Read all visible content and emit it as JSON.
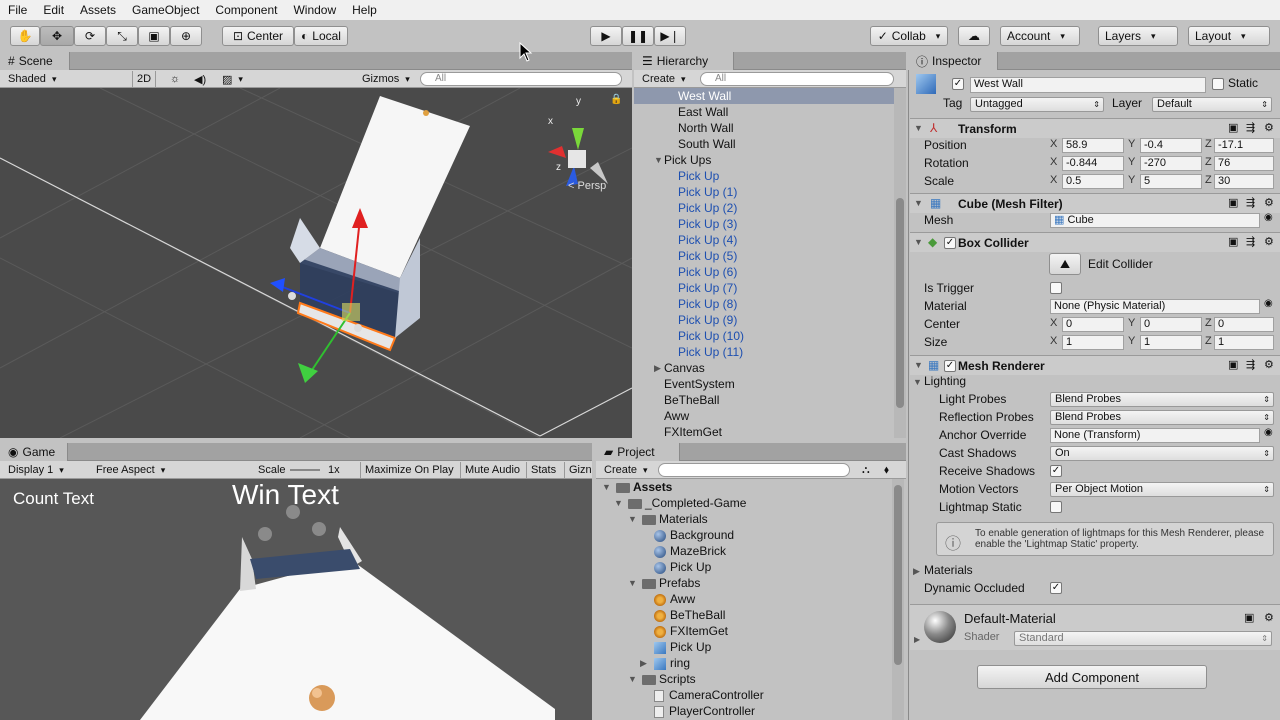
{
  "menu": [
    "File",
    "Edit",
    "Assets",
    "GameObject",
    "Component",
    "Window",
    "Help"
  ],
  "toolbar": {
    "pivot": "Center",
    "space": "Local",
    "collab": "Collab",
    "account": "Account",
    "layers": "Layers",
    "layout": "Layout"
  },
  "scene": {
    "tab": "Scene",
    "shading": "Shaded",
    "mode2d": "2D",
    "gizmos": "Gizmos",
    "search_placeholder": "All",
    "persp": "Persp",
    "axis_x": "x",
    "axis_y": "y",
    "axis_z": "z"
  },
  "hierarchy": {
    "tab": "Hierarchy",
    "create": "Create",
    "search_placeholder": "All",
    "items": [
      {
        "label": "West Wall",
        "style": "selected"
      },
      {
        "label": "East Wall",
        "style": "child"
      },
      {
        "label": "North Wall",
        "style": "child"
      },
      {
        "label": "South Wall",
        "style": "child"
      },
      {
        "label": "Pick Ups",
        "style": "parent"
      },
      {
        "label": "Pick Up",
        "style": "prefab"
      },
      {
        "label": "Pick Up (1)",
        "style": "prefab"
      },
      {
        "label": "Pick Up (2)",
        "style": "prefab"
      },
      {
        "label": "Pick Up (3)",
        "style": "prefab"
      },
      {
        "label": "Pick Up (4)",
        "style": "prefab"
      },
      {
        "label": "Pick Up (5)",
        "style": "prefab"
      },
      {
        "label": "Pick Up (6)",
        "style": "prefab"
      },
      {
        "label": "Pick Up (7)",
        "style": "prefab"
      },
      {
        "label": "Pick Up (8)",
        "style": "prefab"
      },
      {
        "label": "Pick Up (9)",
        "style": "prefab"
      },
      {
        "label": "Pick Up (10)",
        "style": "prefab"
      },
      {
        "label": "Pick Up (11)",
        "style": "prefab"
      },
      {
        "label": "Canvas",
        "style": "collapsed"
      },
      {
        "label": "EventSystem",
        "style": "root"
      },
      {
        "label": "BeTheBall",
        "style": "root"
      },
      {
        "label": "Aww",
        "style": "root"
      },
      {
        "label": "FXItemGet",
        "style": "root"
      }
    ]
  },
  "game": {
    "tab": "Game",
    "display": "Display 1",
    "aspect": "Free Aspect",
    "scale_label": "Scale",
    "scale_value": "1x",
    "maximize": "Maximize On Play",
    "mute": "Mute Audio",
    "stats": "Stats",
    "gizmos": "Gizn",
    "count_text": "Count Text",
    "win_text": "Win Text"
  },
  "project": {
    "tab": "Project",
    "create": "Create",
    "items": [
      {
        "label": "Assets",
        "icon": "folder",
        "bold": true
      },
      {
        "label": "_Completed-Game",
        "icon": "folder"
      },
      {
        "label": "Materials",
        "icon": "folder"
      },
      {
        "label": "Background",
        "icon": "sphere"
      },
      {
        "label": "MazeBrick",
        "icon": "sphere"
      },
      {
        "label": "Pick Up",
        "icon": "sphere"
      },
      {
        "label": "Prefabs",
        "icon": "folder"
      },
      {
        "label": "Aww",
        "icon": "prefab"
      },
      {
        "label": "BeTheBall",
        "icon": "prefab"
      },
      {
        "label": "FXItemGet",
        "icon": "prefab"
      },
      {
        "label": "Pick Up",
        "icon": "cube"
      },
      {
        "label": "ring",
        "icon": "cube"
      },
      {
        "label": "Scripts",
        "icon": "folder"
      },
      {
        "label": "CameraController",
        "icon": "script"
      },
      {
        "label": "PlayerController",
        "icon": "script"
      }
    ]
  },
  "inspector": {
    "tab": "Inspector",
    "object_name": "West Wall",
    "static_label": "Static",
    "tag_label": "Tag",
    "tag_value": "Untagged",
    "layer_label": "Layer",
    "layer_value": "Default",
    "transform": {
      "title": "Transform",
      "position_label": "Position",
      "rotation_label": "Rotation",
      "scale_label": "Scale",
      "position": {
        "x": "58.9",
        "y": "-0.4",
        "z": "-17.1"
      },
      "rotation": {
        "x": "-0.844",
        "y": "-270",
        "z": "76"
      },
      "scale": {
        "x": "0.5",
        "y": "5",
        "z": "30"
      }
    },
    "mesh_filter": {
      "title": "Cube (Mesh Filter)",
      "mesh_label": "Mesh",
      "mesh_value": "Cube"
    },
    "box_collider": {
      "title": "Box Collider",
      "edit_label": "Edit Collider",
      "is_trigger_label": "Is Trigger",
      "material_label": "Material",
      "material_value": "None (Physic Material)",
      "center_label": "Center",
      "size_label": "Size",
      "center": {
        "x": "0",
        "y": "0",
        "z": "0"
      },
      "size": {
        "x": "1",
        "y": "1",
        "z": "1"
      }
    },
    "mesh_renderer": {
      "title": "Mesh Renderer",
      "lighting_label": "Lighting",
      "light_probes_label": "Light Probes",
      "light_probes_value": "Blend Probes",
      "reflection_probes_label": "Reflection Probes",
      "reflection_probes_value": "Blend Probes",
      "anchor_label": "Anchor Override",
      "anchor_value": "None (Transform)",
      "cast_shadows_label": "Cast Shadows",
      "cast_shadows_value": "On",
      "receive_shadows_label": "Receive Shadows",
      "motion_vectors_label": "Motion Vectors",
      "motion_vectors_value": "Per Object Motion",
      "lightmap_static_label": "Lightmap Static",
      "info_text": "To enable generation of lightmaps for this Mesh Renderer, please enable the 'Lightmap Static' property.",
      "materials_label": "Materials",
      "dynamic_occluded_label": "Dynamic Occluded"
    },
    "material": {
      "name": "Default-Material",
      "shader_label": "Shader",
      "shader_value": "Standard"
    },
    "add_component": "Add Component"
  },
  "axis_labels": {
    "x": "X",
    "y": "Y",
    "z": "Z"
  },
  "colors": {
    "accent_blue": "#1d4fb0",
    "selection": "#8e98ad",
    "scene_bg": "#4a4a4a"
  }
}
